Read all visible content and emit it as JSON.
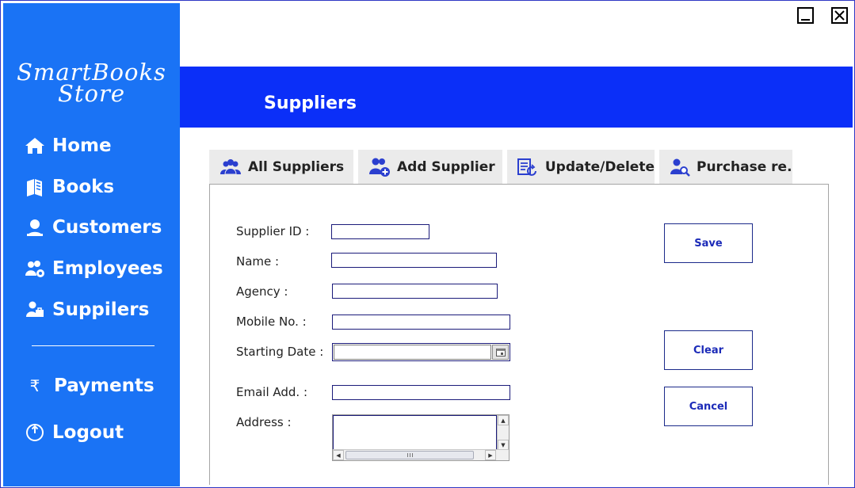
{
  "logo": {
    "line1": "SmartBooks",
    "line2": "Store"
  },
  "sidebar": {
    "items": [
      {
        "label": "Home",
        "icon": "home-icon"
      },
      {
        "label": "Books",
        "icon": "books-icon"
      },
      {
        "label": "Customers",
        "icon": "customer-icon"
      },
      {
        "label": "Employees",
        "icon": "employees-icon"
      },
      {
        "label": "Suppilers",
        "icon": "supplier-icon"
      },
      {
        "label": "Payments",
        "icon": "rupee-icon"
      },
      {
        "label": "Logout",
        "icon": "power-icon"
      }
    ]
  },
  "header": {
    "title": "Suppliers"
  },
  "tabs": [
    {
      "label": "All Suppliers",
      "icon": "users-icon"
    },
    {
      "label": "Add Supplier",
      "icon": "add-user-icon"
    },
    {
      "label": "Update/Delete",
      "icon": "update-icon"
    },
    {
      "label": "Purchase re..",
      "icon": "user-search-icon"
    }
  ],
  "form": {
    "supplier_id_label": "Supplier ID :",
    "name_label": "Name :",
    "agency_label": "Agency :",
    "mobile_label": "Mobile No. :",
    "starting_date_label": "Starting Date :",
    "email_label": "Email Add. :",
    "address_label": "Address :",
    "supplier_id_value": "",
    "name_value": "",
    "agency_value": "",
    "mobile_value": "",
    "email_value": "",
    "address_value": ""
  },
  "buttons": {
    "save": "Save",
    "clear": "Clear",
    "cancel": "Cancel"
  },
  "colors": {
    "sidebar": "#1a73f5",
    "header": "#0b2ff8",
    "button_text": "#1c2bb8"
  }
}
